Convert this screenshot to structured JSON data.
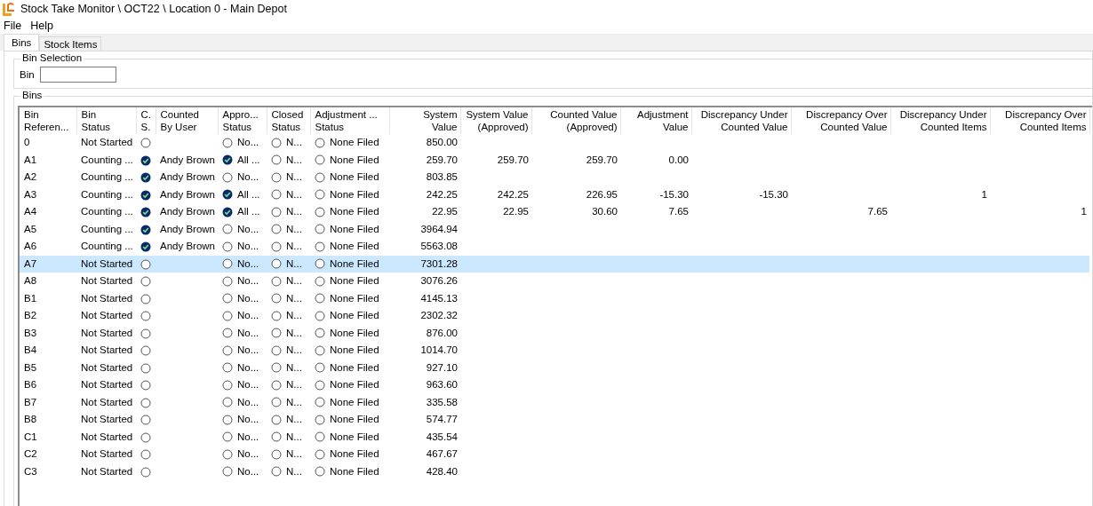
{
  "window": {
    "title": "Stock Take Monitor \\ OCT22 \\ Location 0 - Main Depot"
  },
  "menu": [
    "File",
    "Help"
  ],
  "tabs": [
    {
      "label": "Bins",
      "selected": true
    },
    {
      "label": "Stock Items",
      "selected": false
    }
  ],
  "bin_selection": {
    "title": "Bin Selection",
    "label": "Bin"
  },
  "bins": {
    "title": "Bins",
    "columns": [
      {
        "label": "Bin\nReferen...",
        "kind": "text"
      },
      {
        "label": "Bin\nStatus",
        "kind": "text"
      },
      {
        "label": "C.\nS.",
        "kind": "check"
      },
      {
        "label": "Counted\nBy User",
        "kind": "text"
      },
      {
        "label": "Appro...\nStatus",
        "kind": "check"
      },
      {
        "label": "Closed\nStatus",
        "kind": "check"
      },
      {
        "label": "Adjustment ...\nStatus",
        "kind": "check"
      },
      {
        "label": "System\nValue",
        "kind": "number"
      },
      {
        "label": "System Value\n(Approved)",
        "kind": "number"
      },
      {
        "label": "Counted Value\n(Approved)",
        "kind": "number"
      },
      {
        "label": "Adjustment\nValue",
        "kind": "number"
      },
      {
        "label": "Discrepancy Under\nCounted Value",
        "kind": "number"
      },
      {
        "label": "Discrepancy Over\nCounted Value",
        "kind": "number"
      },
      {
        "label": "Discrepancy Under\nCounted Items",
        "kind": "number"
      },
      {
        "label": "Discrepancy Over\nCounted Items",
        "kind": "number"
      }
    ],
    "rows": [
      {
        "selected": false,
        "cells": [
          "0",
          "Not Started",
          {
            "checked": false,
            "text": ""
          },
          "",
          {
            "checked": false,
            "text": "No..."
          },
          {
            "checked": false,
            "text": "N..."
          },
          {
            "checked": false,
            "text": "None Filed"
          },
          "850.00",
          "",
          "",
          "",
          "",
          "",
          "",
          ""
        ]
      },
      {
        "selected": false,
        "cells": [
          "A1",
          "Counting ...",
          {
            "checked": true,
            "text": ""
          },
          "Andy Brown",
          {
            "checked": true,
            "text": "All ..."
          },
          {
            "checked": false,
            "text": "N..."
          },
          {
            "checked": false,
            "text": "None Filed"
          },
          "259.70",
          "259.70",
          "259.70",
          "0.00",
          "",
          "",
          "",
          ""
        ]
      },
      {
        "selected": false,
        "cells": [
          "A2",
          "Counting ...",
          {
            "checked": true,
            "text": ""
          },
          "Andy Brown",
          {
            "checked": false,
            "text": "No..."
          },
          {
            "checked": false,
            "text": "N..."
          },
          {
            "checked": false,
            "text": "None Filed"
          },
          "803.85",
          "",
          "",
          "",
          "",
          "",
          "",
          ""
        ]
      },
      {
        "selected": false,
        "cells": [
          "A3",
          "Counting ...",
          {
            "checked": true,
            "text": ""
          },
          "Andy Brown",
          {
            "checked": true,
            "text": "All ..."
          },
          {
            "checked": false,
            "text": "N..."
          },
          {
            "checked": false,
            "text": "None Filed"
          },
          "242.25",
          "242.25",
          "226.95",
          "-15.30",
          "-15.30",
          "",
          "1",
          ""
        ]
      },
      {
        "selected": false,
        "cells": [
          "A4",
          "Counting ...",
          {
            "checked": true,
            "text": ""
          },
          "Andy Brown",
          {
            "checked": true,
            "text": "All ..."
          },
          {
            "checked": false,
            "text": "N..."
          },
          {
            "checked": false,
            "text": "None Filed"
          },
          "22.95",
          "22.95",
          "30.60",
          "7.65",
          "",
          "7.65",
          "",
          "1"
        ]
      },
      {
        "selected": false,
        "cells": [
          "A5",
          "Counting ...",
          {
            "checked": true,
            "text": ""
          },
          "Andy Brown",
          {
            "checked": false,
            "text": "No..."
          },
          {
            "checked": false,
            "text": "N..."
          },
          {
            "checked": false,
            "text": "None Filed"
          },
          "3964.94",
          "",
          "",
          "",
          "",
          "",
          "",
          ""
        ]
      },
      {
        "selected": false,
        "cells": [
          "A6",
          "Counting ...",
          {
            "checked": true,
            "text": ""
          },
          "Andy Brown",
          {
            "checked": false,
            "text": "No..."
          },
          {
            "checked": false,
            "text": "N..."
          },
          {
            "checked": false,
            "text": "None Filed"
          },
          "5563.08",
          "",
          "",
          "",
          "",
          "",
          "",
          ""
        ]
      },
      {
        "selected": true,
        "cells": [
          "A7",
          "Not Started",
          {
            "checked": false,
            "text": ""
          },
          "",
          {
            "checked": false,
            "text": "No..."
          },
          {
            "checked": false,
            "text": "N..."
          },
          {
            "checked": false,
            "text": "None Filed"
          },
          "7301.28",
          "",
          "",
          "",
          "",
          "",
          "",
          ""
        ]
      },
      {
        "selected": false,
        "cells": [
          "A8",
          "Not Started",
          {
            "checked": false,
            "text": ""
          },
          "",
          {
            "checked": false,
            "text": "No..."
          },
          {
            "checked": false,
            "text": "N..."
          },
          {
            "checked": false,
            "text": "None Filed"
          },
          "3076.26",
          "",
          "",
          "",
          "",
          "",
          "",
          ""
        ]
      },
      {
        "selected": false,
        "cells": [
          "B1",
          "Not Started",
          {
            "checked": false,
            "text": ""
          },
          "",
          {
            "checked": false,
            "text": "No..."
          },
          {
            "checked": false,
            "text": "N..."
          },
          {
            "checked": false,
            "text": "None Filed"
          },
          "4145.13",
          "",
          "",
          "",
          "",
          "",
          "",
          ""
        ]
      },
      {
        "selected": false,
        "cells": [
          "B2",
          "Not Started",
          {
            "checked": false,
            "text": ""
          },
          "",
          {
            "checked": false,
            "text": "No..."
          },
          {
            "checked": false,
            "text": "N..."
          },
          {
            "checked": false,
            "text": "None Filed"
          },
          "2302.32",
          "",
          "",
          "",
          "",
          "",
          "",
          ""
        ]
      },
      {
        "selected": false,
        "cells": [
          "B3",
          "Not Started",
          {
            "checked": false,
            "text": ""
          },
          "",
          {
            "checked": false,
            "text": "No..."
          },
          {
            "checked": false,
            "text": "N..."
          },
          {
            "checked": false,
            "text": "None Filed"
          },
          "876.00",
          "",
          "",
          "",
          "",
          "",
          "",
          ""
        ]
      },
      {
        "selected": false,
        "cells": [
          "B4",
          "Not Started",
          {
            "checked": false,
            "text": ""
          },
          "",
          {
            "checked": false,
            "text": "No..."
          },
          {
            "checked": false,
            "text": "N..."
          },
          {
            "checked": false,
            "text": "None Filed"
          },
          "1014.70",
          "",
          "",
          "",
          "",
          "",
          "",
          ""
        ]
      },
      {
        "selected": false,
        "cells": [
          "B5",
          "Not Started",
          {
            "checked": false,
            "text": ""
          },
          "",
          {
            "checked": false,
            "text": "No..."
          },
          {
            "checked": false,
            "text": "N..."
          },
          {
            "checked": false,
            "text": "None Filed"
          },
          "927.10",
          "",
          "",
          "",
          "",
          "",
          "",
          ""
        ]
      },
      {
        "selected": false,
        "cells": [
          "B6",
          "Not Started",
          {
            "checked": false,
            "text": ""
          },
          "",
          {
            "checked": false,
            "text": "No..."
          },
          {
            "checked": false,
            "text": "N..."
          },
          {
            "checked": false,
            "text": "None Filed"
          },
          "963.60",
          "",
          "",
          "",
          "",
          "",
          "",
          ""
        ]
      },
      {
        "selected": false,
        "cells": [
          "B7",
          "Not Started",
          {
            "checked": false,
            "text": ""
          },
          "",
          {
            "checked": false,
            "text": "No..."
          },
          {
            "checked": false,
            "text": "N..."
          },
          {
            "checked": false,
            "text": "None Filed"
          },
          "335.58",
          "",
          "",
          "",
          "",
          "",
          "",
          ""
        ]
      },
      {
        "selected": false,
        "cells": [
          "B8",
          "Not Started",
          {
            "checked": false,
            "text": ""
          },
          "",
          {
            "checked": false,
            "text": "No..."
          },
          {
            "checked": false,
            "text": "N..."
          },
          {
            "checked": false,
            "text": "None Filed"
          },
          "574.77",
          "",
          "",
          "",
          "",
          "",
          "",
          ""
        ]
      },
      {
        "selected": false,
        "cells": [
          "C1",
          "Not Started",
          {
            "checked": false,
            "text": ""
          },
          "",
          {
            "checked": false,
            "text": "No..."
          },
          {
            "checked": false,
            "text": "N..."
          },
          {
            "checked": false,
            "text": "None Filed"
          },
          "435.54",
          "",
          "",
          "",
          "",
          "",
          "",
          ""
        ]
      },
      {
        "selected": false,
        "cells": [
          "C2",
          "Not Started",
          {
            "checked": false,
            "text": ""
          },
          "",
          {
            "checked": false,
            "text": "No..."
          },
          {
            "checked": false,
            "text": "N..."
          },
          {
            "checked": false,
            "text": "None Filed"
          },
          "467.67",
          "",
          "",
          "",
          "",
          "",
          "",
          ""
        ]
      },
      {
        "selected": false,
        "cells": [
          "C3",
          "Not Started",
          {
            "checked": false,
            "text": ""
          },
          "",
          {
            "checked": false,
            "text": "No..."
          },
          {
            "checked": false,
            "text": "N..."
          },
          {
            "checked": false,
            "text": "None Filed"
          },
          "428.40",
          "",
          "",
          "",
          "",
          "",
          "",
          ""
        ]
      }
    ]
  }
}
